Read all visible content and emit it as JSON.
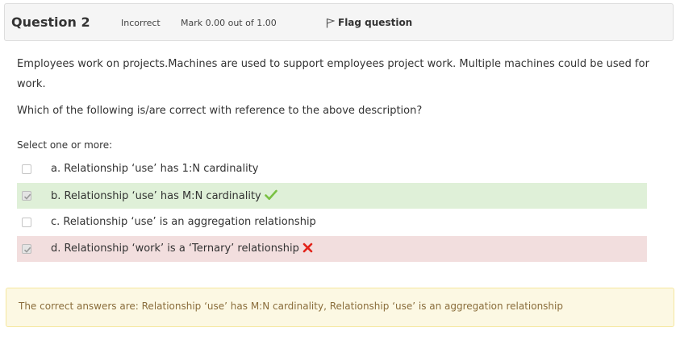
{
  "question_info": {
    "number": "Question 2",
    "state": "Incorrect",
    "grade": "Mark 0.00 out of 1.00",
    "flag_label": "Flag question"
  },
  "question_text": {
    "description": "Employees work on projects.Machines are used to support employees project work. Multiple machines could be used for work.",
    "ask": "Which of the following is/are correct with reference to the above description?"
  },
  "prompt": "Select one or more:",
  "answers": [
    {
      "label": "a. Relationship ‘use’ has 1:N cardinality",
      "checked": false,
      "status": "none"
    },
    {
      "label": "b. Relationship ‘use’ has M:N cardinality",
      "checked": true,
      "status": "correct"
    },
    {
      "label": "c. Relationship ‘use’ is an aggregation relationship",
      "checked": false,
      "status": "none"
    },
    {
      "label": "d. Relationship ‘work’ is a ‘Ternary’ relationship",
      "checked": true,
      "status": "incorrect"
    }
  ],
  "feedback": {
    "right_answer": "The correct answers are: Relationship ‘use’ has M:N cardinality, Relationship ‘use’ is an aggregation relationship"
  },
  "colors": {
    "correct_bg": "#dff0d8",
    "incorrect_bg": "#f2dede",
    "correct_icon": "#7ac143",
    "incorrect_icon": "#e2231a",
    "feedback_bg": "#fcf8e3",
    "feedback_text": "#8a6d3b"
  },
  "icons": {
    "flag": "flag-icon",
    "correct": "checkmark-icon",
    "incorrect": "cross-icon"
  }
}
